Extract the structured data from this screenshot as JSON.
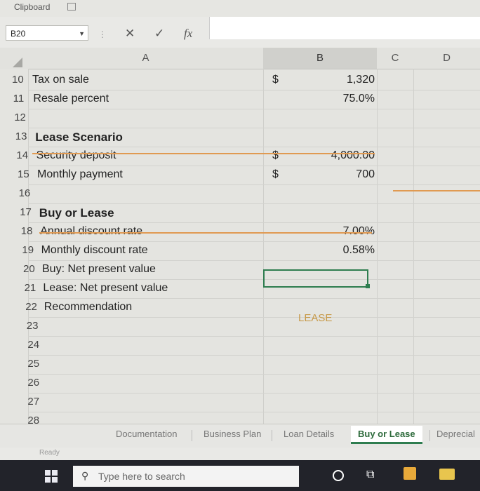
{
  "ribbon": {
    "group_label": "Clipboard"
  },
  "formula_bar": {
    "name_box": "B20",
    "cancel_icon": "✕",
    "enter_icon": "✓",
    "fx_icon": "fx",
    "formula": ""
  },
  "columns": [
    "A",
    "B",
    "C",
    "D"
  ],
  "rows": [
    {
      "n": "10",
      "label": "Tax on sale",
      "currency": "$",
      "value": "1,320",
      "bold": false
    },
    {
      "n": "11",
      "label": "Resale percent",
      "currency": "",
      "value": "75.0%",
      "bold": false
    },
    {
      "n": "12",
      "label": "",
      "currency": "",
      "value": "",
      "bold": false
    },
    {
      "n": "13",
      "label": "Lease Scenario",
      "currency": "",
      "value": "",
      "bold": true
    },
    {
      "n": "14",
      "label": "Security deposit",
      "currency": "$",
      "value": "4,000.00",
      "bold": false
    },
    {
      "n": "15",
      "label": "Monthly payment",
      "currency": "$",
      "value": "700",
      "bold": false
    },
    {
      "n": "16",
      "label": "",
      "currency": "",
      "value": "",
      "bold": false
    },
    {
      "n": "17",
      "label": "Buy or Lease",
      "currency": "",
      "value": "",
      "bold": true
    },
    {
      "n": "18",
      "label": "Annual discount rate",
      "currency": "",
      "value": "7.00%",
      "bold": false
    },
    {
      "n": "19",
      "label": "Monthly discount rate",
      "currency": "",
      "value": "0.58%",
      "bold": false
    },
    {
      "n": "20",
      "label": "Buy: Net present value",
      "currency": "",
      "value": "",
      "bold": false
    },
    {
      "n": "21",
      "label": "Lease: Net present value",
      "currency": "",
      "value": "",
      "bold": false
    },
    {
      "n": "22",
      "label": "Recommendation",
      "currency": "",
      "value": "",
      "bold": false
    },
    {
      "n": "23",
      "label": "",
      "currency": "",
      "value": "",
      "bold": false
    },
    {
      "n": "24",
      "label": "",
      "currency": "",
      "value": "",
      "bold": false
    },
    {
      "n": "25",
      "label": "",
      "currency": "",
      "value": "",
      "bold": false
    },
    {
      "n": "26",
      "label": "",
      "currency": "",
      "value": "",
      "bold": false
    },
    {
      "n": "27",
      "label": "",
      "currency": "",
      "value": "",
      "bold": false
    },
    {
      "n": "28",
      "label": "",
      "currency": "",
      "value": "",
      "bold": false
    }
  ],
  "recommendation_value": "LEASE",
  "sheet_tabs": [
    "Documentation",
    "Business Plan",
    "Loan Details",
    "Buy or Lease",
    "Deprecial"
  ],
  "active_tab": "Buy or Lease",
  "status": "Ready",
  "taskbar": {
    "search_placeholder": "Type here to search"
  },
  "colors": {
    "accent": "#2e7d4f",
    "divider": "#e09a52",
    "lease_text": "#c79a4a"
  }
}
